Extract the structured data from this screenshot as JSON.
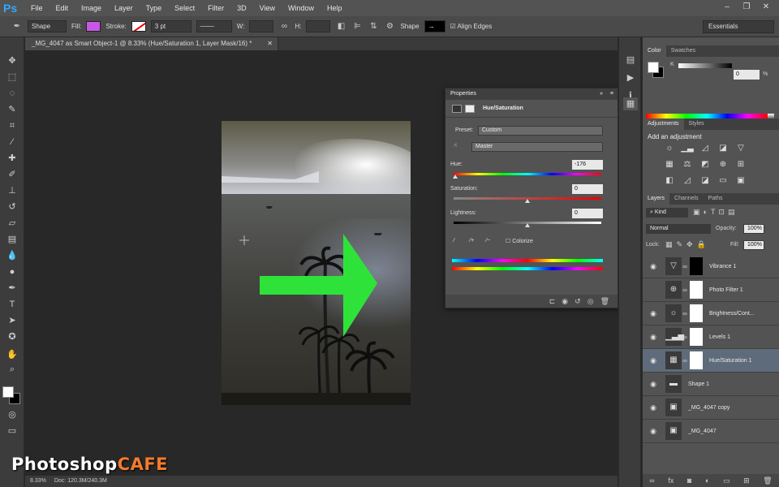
{
  "app": {
    "logo": "Ps"
  },
  "menu": [
    "File",
    "Edit",
    "Image",
    "Layer",
    "Type",
    "Select",
    "Filter",
    "3D",
    "View",
    "Window",
    "Help"
  ],
  "window_controls": [
    "–",
    "❐",
    "✕"
  ],
  "options_bar": {
    "mode": "Shape",
    "fill_label": "Fill:",
    "stroke_label": "Stroke:",
    "stroke_width": "3 pt",
    "w_label": "W:",
    "h_label": "H:",
    "shape_label": "Shape",
    "align_edges": "Align Edges",
    "workspace": "Essentials",
    "fill_color": "#c857e6"
  },
  "document": {
    "tab_title": "_MG_4047 as Smart Object-1 @ 8.33% (Hue/Saturation 1, Layer Mask/16) *",
    "zoom": "8.33%",
    "doc_size": "Doc: 120.3M/240.3M"
  },
  "properties": {
    "panel_title": "Properties",
    "adjustment_name": "Hue/Saturation",
    "preset_label": "Preset:",
    "preset_value": "Custom",
    "channel_value": "Master",
    "hue_label": "Hue:",
    "hue_value": "-176",
    "hue_fraction": 0.01,
    "saturation_label": "Saturation:",
    "saturation_value": "0",
    "lightness_label": "Lightness:",
    "lightness_value": "0",
    "colorize_label": "Colorize"
  },
  "color_panel": {
    "tabs": [
      "Color",
      "Swatches"
    ],
    "channel_label": "K",
    "value": "0",
    "unit": "%"
  },
  "adjustments_panel": {
    "tabs": [
      "Adjustments",
      "Styles"
    ],
    "heading": "Add an adjustment"
  },
  "layers_panel": {
    "tabs": [
      "Layers",
      "Channels",
      "Paths"
    ],
    "kind_filter": "Kind",
    "blend_mode": "Normal",
    "opacity_label": "Opacity:",
    "opacity_value": "100%",
    "lock_label": "Lock:",
    "fill_label": "Fill:",
    "fill_value": "100%",
    "layers": [
      {
        "name": "Vibrance 1",
        "visible": true,
        "icon": "▽",
        "mask": "black"
      },
      {
        "name": "Photo Filter 1",
        "visible": false,
        "icon": "⊕",
        "mask": "white"
      },
      {
        "name": "Brightness/Cont...",
        "visible": true,
        "icon": "☼",
        "mask": "white"
      },
      {
        "name": "Levels 1",
        "visible": true,
        "icon": "▁▃▅",
        "mask": "white"
      },
      {
        "name": "Hue/Saturation 1",
        "visible": true,
        "icon": "▦",
        "mask": "white",
        "selected": true
      },
      {
        "name": "Shape 1",
        "visible": true,
        "icon": "▬",
        "mask": "none"
      },
      {
        "name": "_MG_4047 copy",
        "visible": true,
        "icon": "▣",
        "mask": "none"
      },
      {
        "name": "_MG_4047",
        "visible": true,
        "icon": "▣",
        "mask": "none"
      }
    ]
  },
  "watermark": {
    "part1": "Photoshop",
    "part2": "CAFE"
  }
}
